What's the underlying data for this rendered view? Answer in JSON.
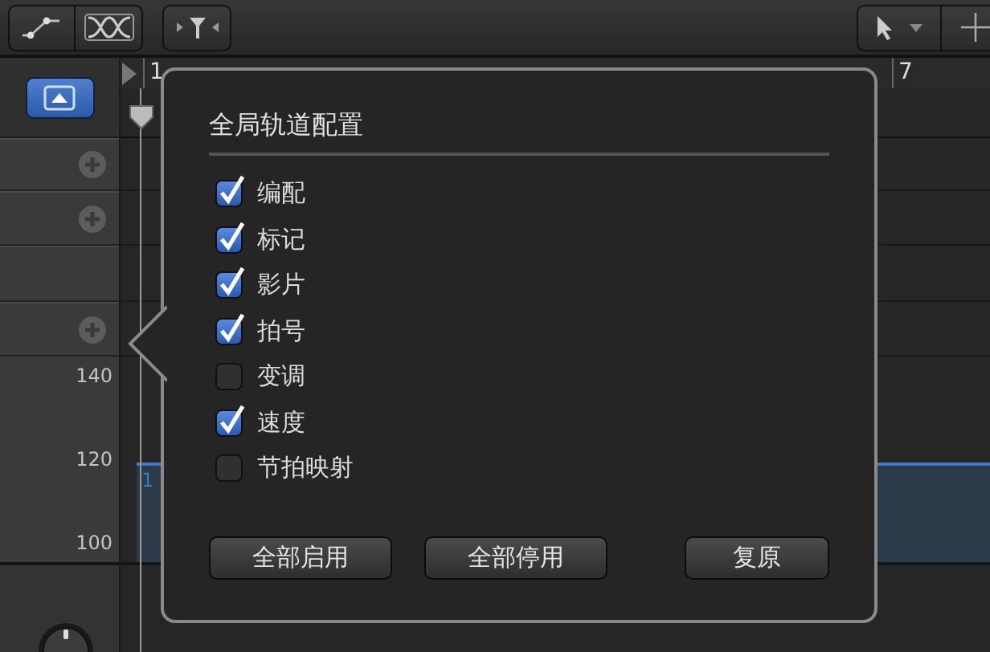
{
  "ruler": {
    "bars": [
      "1",
      "7"
    ]
  },
  "tracks": [
    {
      "kind": "add"
    },
    {
      "kind": "add"
    },
    {
      "kind": "empty"
    },
    {
      "kind": "add"
    }
  ],
  "tempo": {
    "scale": [
      "140",
      "120",
      "100"
    ],
    "region_label": "1"
  },
  "popover": {
    "title": "全局轨道配置",
    "options": [
      {
        "label": "编配",
        "checked": true
      },
      {
        "label": "标记",
        "checked": true
      },
      {
        "label": "影片",
        "checked": true
      },
      {
        "label": "拍号",
        "checked": true
      },
      {
        "label": "变调",
        "checked": false
      },
      {
        "label": "速度",
        "checked": true
      },
      {
        "label": "节拍映射",
        "checked": false
      }
    ],
    "buttons": [
      "全部启用",
      "全部停用",
      "复原"
    ]
  }
}
